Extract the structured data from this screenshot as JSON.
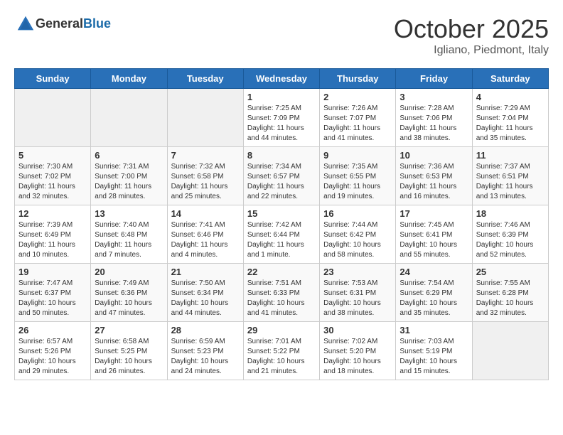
{
  "header": {
    "logo_general": "General",
    "logo_blue": "Blue",
    "month_title": "October 2025",
    "location": "Igliano, Piedmont, Italy"
  },
  "days_of_week": [
    "Sunday",
    "Monday",
    "Tuesday",
    "Wednesday",
    "Thursday",
    "Friday",
    "Saturday"
  ],
  "weeks": [
    [
      {
        "day": "",
        "info": ""
      },
      {
        "day": "",
        "info": ""
      },
      {
        "day": "",
        "info": ""
      },
      {
        "day": "1",
        "info": "Sunrise: 7:25 AM\nSunset: 7:09 PM\nDaylight: 11 hours and 44 minutes."
      },
      {
        "day": "2",
        "info": "Sunrise: 7:26 AM\nSunset: 7:07 PM\nDaylight: 11 hours and 41 minutes."
      },
      {
        "day": "3",
        "info": "Sunrise: 7:28 AM\nSunset: 7:06 PM\nDaylight: 11 hours and 38 minutes."
      },
      {
        "day": "4",
        "info": "Sunrise: 7:29 AM\nSunset: 7:04 PM\nDaylight: 11 hours and 35 minutes."
      }
    ],
    [
      {
        "day": "5",
        "info": "Sunrise: 7:30 AM\nSunset: 7:02 PM\nDaylight: 11 hours and 32 minutes."
      },
      {
        "day": "6",
        "info": "Sunrise: 7:31 AM\nSunset: 7:00 PM\nDaylight: 11 hours and 28 minutes."
      },
      {
        "day": "7",
        "info": "Sunrise: 7:32 AM\nSunset: 6:58 PM\nDaylight: 11 hours and 25 minutes."
      },
      {
        "day": "8",
        "info": "Sunrise: 7:34 AM\nSunset: 6:57 PM\nDaylight: 11 hours and 22 minutes."
      },
      {
        "day": "9",
        "info": "Sunrise: 7:35 AM\nSunset: 6:55 PM\nDaylight: 11 hours and 19 minutes."
      },
      {
        "day": "10",
        "info": "Sunrise: 7:36 AM\nSunset: 6:53 PM\nDaylight: 11 hours and 16 minutes."
      },
      {
        "day": "11",
        "info": "Sunrise: 7:37 AM\nSunset: 6:51 PM\nDaylight: 11 hours and 13 minutes."
      }
    ],
    [
      {
        "day": "12",
        "info": "Sunrise: 7:39 AM\nSunset: 6:49 PM\nDaylight: 11 hours and 10 minutes."
      },
      {
        "day": "13",
        "info": "Sunrise: 7:40 AM\nSunset: 6:48 PM\nDaylight: 11 hours and 7 minutes."
      },
      {
        "day": "14",
        "info": "Sunrise: 7:41 AM\nSunset: 6:46 PM\nDaylight: 11 hours and 4 minutes."
      },
      {
        "day": "15",
        "info": "Sunrise: 7:42 AM\nSunset: 6:44 PM\nDaylight: 11 hours and 1 minute."
      },
      {
        "day": "16",
        "info": "Sunrise: 7:44 AM\nSunset: 6:42 PM\nDaylight: 10 hours and 58 minutes."
      },
      {
        "day": "17",
        "info": "Sunrise: 7:45 AM\nSunset: 6:41 PM\nDaylight: 10 hours and 55 minutes."
      },
      {
        "day": "18",
        "info": "Sunrise: 7:46 AM\nSunset: 6:39 PM\nDaylight: 10 hours and 52 minutes."
      }
    ],
    [
      {
        "day": "19",
        "info": "Sunrise: 7:47 AM\nSunset: 6:37 PM\nDaylight: 10 hours and 50 minutes."
      },
      {
        "day": "20",
        "info": "Sunrise: 7:49 AM\nSunset: 6:36 PM\nDaylight: 10 hours and 47 minutes."
      },
      {
        "day": "21",
        "info": "Sunrise: 7:50 AM\nSunset: 6:34 PM\nDaylight: 10 hours and 44 minutes."
      },
      {
        "day": "22",
        "info": "Sunrise: 7:51 AM\nSunset: 6:33 PM\nDaylight: 10 hours and 41 minutes."
      },
      {
        "day": "23",
        "info": "Sunrise: 7:53 AM\nSunset: 6:31 PM\nDaylight: 10 hours and 38 minutes."
      },
      {
        "day": "24",
        "info": "Sunrise: 7:54 AM\nSunset: 6:29 PM\nDaylight: 10 hours and 35 minutes."
      },
      {
        "day": "25",
        "info": "Sunrise: 7:55 AM\nSunset: 6:28 PM\nDaylight: 10 hours and 32 minutes."
      }
    ],
    [
      {
        "day": "26",
        "info": "Sunrise: 6:57 AM\nSunset: 5:26 PM\nDaylight: 10 hours and 29 minutes."
      },
      {
        "day": "27",
        "info": "Sunrise: 6:58 AM\nSunset: 5:25 PM\nDaylight: 10 hours and 26 minutes."
      },
      {
        "day": "28",
        "info": "Sunrise: 6:59 AM\nSunset: 5:23 PM\nDaylight: 10 hours and 24 minutes."
      },
      {
        "day": "29",
        "info": "Sunrise: 7:01 AM\nSunset: 5:22 PM\nDaylight: 10 hours and 21 minutes."
      },
      {
        "day": "30",
        "info": "Sunrise: 7:02 AM\nSunset: 5:20 PM\nDaylight: 10 hours and 18 minutes."
      },
      {
        "day": "31",
        "info": "Sunrise: 7:03 AM\nSunset: 5:19 PM\nDaylight: 10 hours and 15 minutes."
      },
      {
        "day": "",
        "info": ""
      }
    ]
  ]
}
